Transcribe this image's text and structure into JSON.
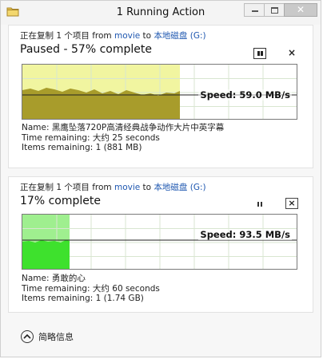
{
  "window": {
    "title": "1 Running Action",
    "controls": {
      "minimize": "minimize",
      "maximize": "maximize",
      "close": "✕"
    }
  },
  "colors": {
    "link": "#1e57b0",
    "paused_fill": "#f1f5a0",
    "paused_area": "#a89c2b",
    "active_fill": "#9fef8f",
    "active_area": "#3ee12d"
  },
  "operations": [
    {
      "copy_prefix": "正在复制 1 个项目 from ",
      "source": "movie",
      "to_word": " to ",
      "destination": "本地磁盘 (G:)",
      "status": "Paused - 57% complete",
      "progress_percent": 57,
      "speed": "Speed: 59.0 MB/s",
      "pause_button": "pause",
      "close_button": "×",
      "name": "Name:  黑鹰坠落720P高清经典战争动作大片中英字幕",
      "time_remaining": "Time remaining:  大约 25 seconds",
      "items_remaining": "Items remaining:  1 (881 MB)"
    },
    {
      "copy_prefix": "正在复制 1 个项目 from ",
      "source": "movie",
      "to_word": " to ",
      "destination": "本地磁盘 (G:)",
      "status": "17% complete",
      "progress_percent": 17,
      "speed": "Speed: 93.5 MB/s",
      "pause_button": "pause",
      "close_button": "×",
      "name": "Name:  勇敢的心",
      "time_remaining": "Time remaining:  大约 60 seconds",
      "items_remaining": "Items remaining:  1 (1.74 GB)"
    }
  ],
  "footer": {
    "label": "简略信息"
  }
}
